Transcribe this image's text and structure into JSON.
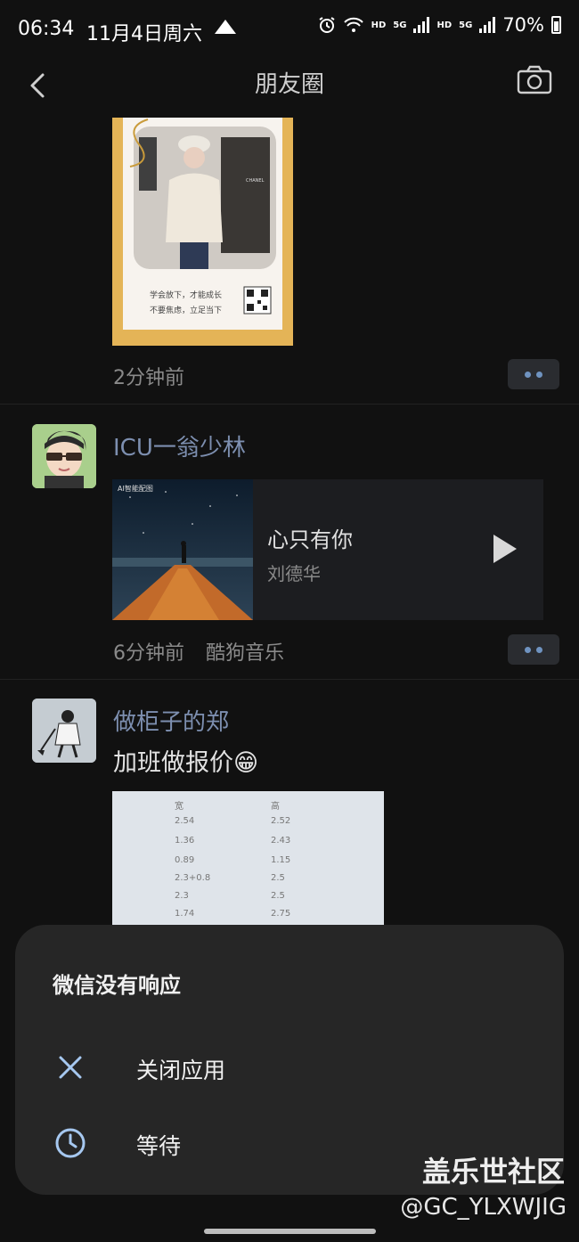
{
  "status_bar": {
    "time": "06:34",
    "date": "11月4日周六",
    "hd1": "HD",
    "g1": "5G",
    "hd2": "HD",
    "g2": "5G",
    "battery": "70%"
  },
  "nav": {
    "title": "朋友圈"
  },
  "posts": [
    {
      "time": "2分钟前",
      "poster_line1": "学会放下，才能成长",
      "poster_line2": "不要焦虑，立足当下",
      "brand": "CHANEL"
    },
    {
      "name": "ICU一翁少林",
      "song": "心只有你",
      "singer": "刘德华",
      "cover_tag": "AI智能配图",
      "time": "6分钟前",
      "source": "酷狗音乐"
    },
    {
      "name": "做柜子的郑",
      "text": "加班做报价😁",
      "sheet_rows": [
        {
          "a": "宽",
          "b": "高"
        },
        {
          "a": "2.54",
          "b": "2.52"
        },
        {
          "a": "1.36",
          "b": "2.43"
        },
        {
          "a": "0.89",
          "b": "1.15"
        },
        {
          "a": "2.3+0.8",
          "b": "2.5"
        },
        {
          "a": "2.3",
          "b": "2.5"
        },
        {
          "a": "1.74",
          "b": "2.75"
        }
      ]
    }
  ],
  "dialog": {
    "title": "微信没有响应",
    "close_label": "关闭应用",
    "wait_label": "等待"
  },
  "watermark": {
    "line1": "盖乐世社区",
    "line2": "@GC_YLXWJIG"
  },
  "colors": {
    "name_blue": "#7d8fb0",
    "dialog_bg": "#262626",
    "bg": "#111111"
  }
}
